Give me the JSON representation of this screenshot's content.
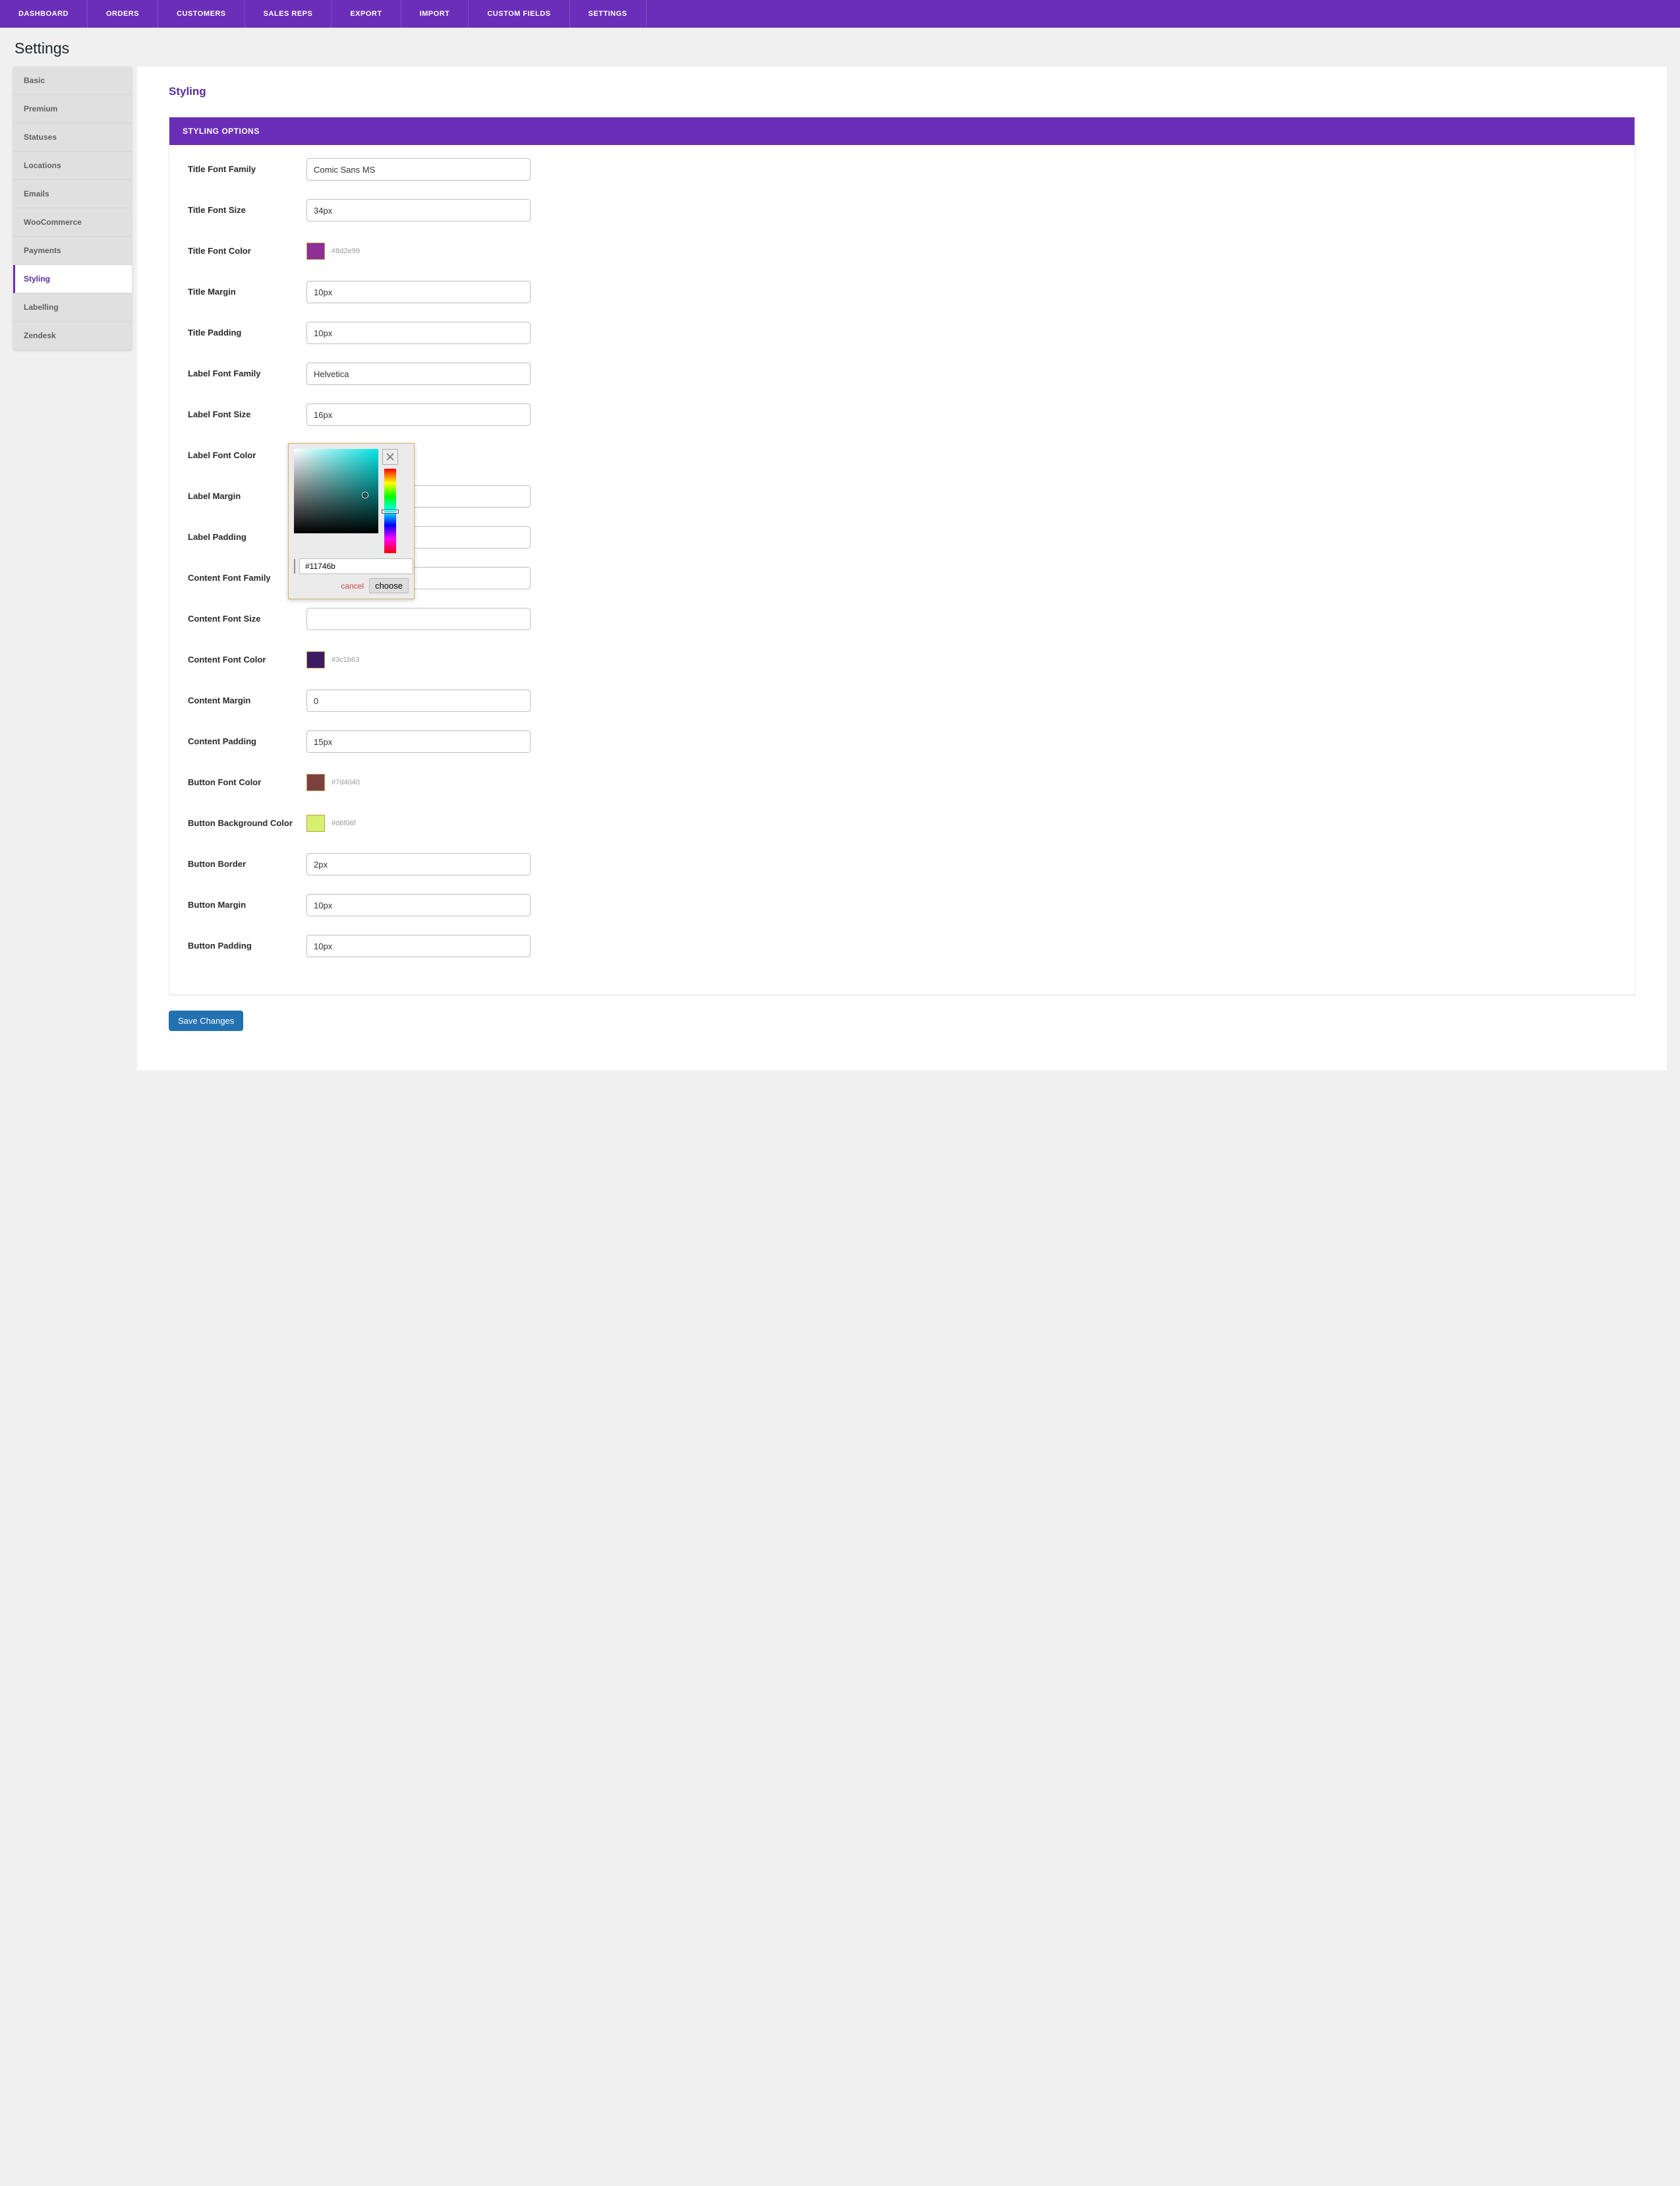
{
  "topNav": [
    "DASHBOARD",
    "ORDERS",
    "CUSTOMERS",
    "SALES REPS",
    "EXPORT",
    "IMPORT",
    "CUSTOM FIELDS",
    "SETTINGS"
  ],
  "pageTitle": "Settings",
  "sidebar": {
    "items": [
      "Basic",
      "Premium",
      "Statuses",
      "Locations",
      "Emails",
      "WooCommerce",
      "Payments",
      "Styling",
      "Labelling",
      "Zendesk"
    ],
    "activeIndex": 7
  },
  "sectionTitle": "Styling",
  "cardHeader": "STYLING OPTIONS",
  "fields": [
    {
      "label": "Title Font Family",
      "type": "text",
      "value": "Comic Sans MS"
    },
    {
      "label": "Title Font Size",
      "type": "text",
      "value": "34px"
    },
    {
      "label": "Title Font Color",
      "type": "color",
      "hex": "#8d2e99"
    },
    {
      "label": "Title Margin",
      "type": "text",
      "value": "10px"
    },
    {
      "label": "Title Padding",
      "type": "text",
      "value": "10px"
    },
    {
      "label": "Label Font Family",
      "type": "text",
      "value": "Helvetica"
    },
    {
      "label": "Label Font Size",
      "type": "text",
      "value": "16px"
    },
    {
      "label": "Label Font Color",
      "type": "color",
      "hex": "#11746b"
    },
    {
      "label": "Label Margin",
      "type": "text",
      "value": ""
    },
    {
      "label": "Label Padding",
      "type": "text",
      "value": ""
    },
    {
      "label": "Content Font Family",
      "type": "text",
      "value": ""
    },
    {
      "label": "Content Font Size",
      "type": "text",
      "value": ""
    },
    {
      "label": "Content Font Color",
      "type": "color",
      "hex": "#3c1b63"
    },
    {
      "label": "Content Margin",
      "type": "text",
      "value": "0"
    },
    {
      "label": "Content Padding",
      "type": "text",
      "value": "15px"
    },
    {
      "label": "Button Font Color",
      "type": "color",
      "hex": "#7d4040"
    },
    {
      "label": "Button Background Color",
      "type": "color",
      "hex": "#d6f06f"
    },
    {
      "label": "Button Border",
      "type": "text",
      "value": "2px"
    },
    {
      "label": "Button Margin",
      "type": "text",
      "value": "10px"
    },
    {
      "label": "Button Padding",
      "type": "text",
      "value": "10px"
    }
  ],
  "picker": {
    "hex": "#11746b",
    "cancel": "cancel",
    "choose": "choose"
  },
  "saveButton": "Save Changes"
}
